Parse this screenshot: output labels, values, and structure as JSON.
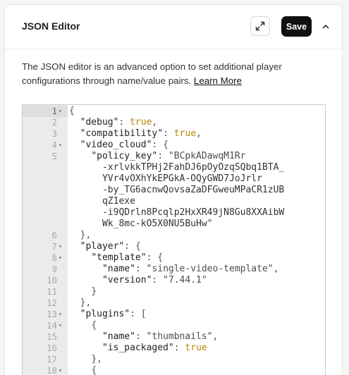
{
  "header": {
    "title": "JSON Editor",
    "save_label": "Save",
    "expand_icon": "expand-icon",
    "collapse_icon": "chevron-up-icon"
  },
  "description": {
    "text": "The JSON editor is an advanced option to set additional player configurations through name/value pairs. ",
    "link": "Learn More"
  },
  "editor": {
    "lines": [
      {
        "num": "1",
        "fold": true,
        "text": "{"
      },
      {
        "num": "2",
        "fold": false,
        "text": "  \"debug\": true,"
      },
      {
        "num": "3",
        "fold": false,
        "text": "  \"compatibility\": true,"
      },
      {
        "num": "4",
        "fold": true,
        "text": "  \"video_cloud\": {"
      },
      {
        "num": "5",
        "fold": false,
        "text": "    \"policy_key\": \"BCpkADawqM1Rr"
      },
      {
        "num": "",
        "fold": false,
        "text": "      -xrlvkkTPHj2FahDJ6pOyOzqSQbq1BTA_"
      },
      {
        "num": "",
        "fold": false,
        "text": "      YVr4vOXhYkEPGkA-OQyGWD7JoJrlr"
      },
      {
        "num": "",
        "fold": false,
        "text": "      -by_TG6acnwQovsaZaDFGweuMPaCR1zUB"
      },
      {
        "num": "",
        "fold": false,
        "text": "      qZ1exe"
      },
      {
        "num": "",
        "fold": false,
        "text": "      -i9QDrln8Pcqlp2HxXR49jN8Gu8XXAibW"
      },
      {
        "num": "",
        "fold": false,
        "text": "      Wk_8mc-kO5X0NU5BuHw\""
      },
      {
        "num": "6",
        "fold": false,
        "text": "  },"
      },
      {
        "num": "7",
        "fold": true,
        "text": "  \"player\": {"
      },
      {
        "num": "8",
        "fold": true,
        "text": "    \"template\": {"
      },
      {
        "num": "9",
        "fold": false,
        "text": "      \"name\": \"single-video-template\","
      },
      {
        "num": "10",
        "fold": false,
        "text": "      \"version\": \"7.44.1\""
      },
      {
        "num": "11",
        "fold": false,
        "text": "    }"
      },
      {
        "num": "12",
        "fold": false,
        "text": "  },"
      },
      {
        "num": "13",
        "fold": true,
        "text": "  \"plugins\": ["
      },
      {
        "num": "14",
        "fold": true,
        "text": "    {"
      },
      {
        "num": "15",
        "fold": false,
        "text": "      \"name\": \"thumbnails\","
      },
      {
        "num": "16",
        "fold": false,
        "text": "      \"is_packaged\": true"
      },
      {
        "num": "17",
        "fold": false,
        "text": "    },"
      },
      {
        "num": "18",
        "fold": true,
        "text": "    {"
      }
    ]
  }
}
